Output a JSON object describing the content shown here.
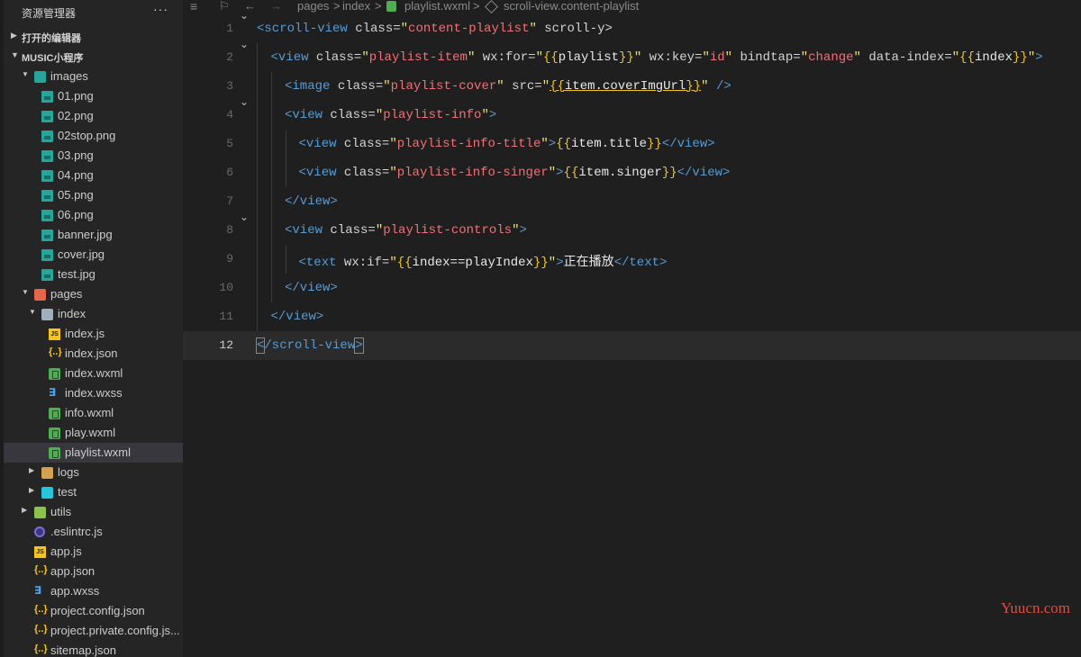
{
  "explorer": {
    "title": "资源管理器",
    "more": "···",
    "open_editors": "打开的编辑器",
    "project": "MUSIC小程序"
  },
  "tree": [
    {
      "name": "images",
      "type": "folder-images",
      "depth": 1,
      "expanded": true
    },
    {
      "name": "01.png",
      "type": "img",
      "depth": 2
    },
    {
      "name": "02.png",
      "type": "img",
      "depth": 2
    },
    {
      "name": "02stop.png",
      "type": "img",
      "depth": 2
    },
    {
      "name": "03.png",
      "type": "img",
      "depth": 2
    },
    {
      "name": "04.png",
      "type": "img",
      "depth": 2
    },
    {
      "name": "05.png",
      "type": "img",
      "depth": 2
    },
    {
      "name": "06.png",
      "type": "img",
      "depth": 2
    },
    {
      "name": "banner.jpg",
      "type": "img",
      "depth": 2
    },
    {
      "name": "cover.jpg",
      "type": "img",
      "depth": 2
    },
    {
      "name": "test.jpg",
      "type": "img",
      "depth": 2
    },
    {
      "name": "pages",
      "type": "folder-pages",
      "depth": 1,
      "expanded": true
    },
    {
      "name": "index",
      "type": "folder-plain",
      "depth": 2,
      "expanded": true
    },
    {
      "name": "index.js",
      "type": "js",
      "depth": 3
    },
    {
      "name": "index.json",
      "type": "json",
      "depth": 3
    },
    {
      "name": "index.wxml",
      "type": "wxml",
      "depth": 3
    },
    {
      "name": "index.wxss",
      "type": "css",
      "depth": 3
    },
    {
      "name": "info.wxml",
      "type": "wxml",
      "depth": 3
    },
    {
      "name": "play.wxml",
      "type": "wxml",
      "depth": 3
    },
    {
      "name": "playlist.wxml",
      "type": "wxml",
      "depth": 3,
      "selected": true
    },
    {
      "name": "logs",
      "type": "folder",
      "depth": 2,
      "expanded": false
    },
    {
      "name": "test",
      "type": "folder-teal",
      "depth": 2,
      "expanded": false
    },
    {
      "name": "utils",
      "type": "folder-green",
      "depth": 1,
      "expanded": false
    },
    {
      "name": ".eslintrc.js",
      "type": "eslint",
      "depth": 1
    },
    {
      "name": "app.js",
      "type": "js",
      "depth": 1
    },
    {
      "name": "app.json",
      "type": "json",
      "depth": 1
    },
    {
      "name": "app.wxss",
      "type": "css",
      "depth": 1
    },
    {
      "name": "project.config.json",
      "type": "json",
      "depth": 1
    },
    {
      "name": "project.private.config.js...",
      "type": "json",
      "depth": 1
    },
    {
      "name": "sitemap.json",
      "type": "json",
      "depth": 1
    }
  ],
  "breadcrumb": {
    "list_icon": "≡",
    "bookmark_icon": "⚐",
    "back": "←",
    "forward": "→",
    "parts": [
      "pages",
      "index",
      "playlist.wxml",
      "scroll-view.content-playlist"
    ],
    "sep": ">"
  },
  "editor": {
    "current_line": 12,
    "lines": [
      {
        "n": "1",
        "indent": 0,
        "fold": true
      },
      {
        "n": "2",
        "indent": 1,
        "fold": true
      },
      {
        "n": "3",
        "indent": 2
      },
      {
        "n": "4",
        "indent": 2,
        "fold": true
      },
      {
        "n": "5",
        "indent": 3
      },
      {
        "n": "6",
        "indent": 3
      },
      {
        "n": "7",
        "indent": 2
      },
      {
        "n": "8",
        "indent": 2,
        "fold": true
      },
      {
        "n": "9",
        "indent": 3
      },
      {
        "n": "10",
        "indent": 2
      },
      {
        "n": "11",
        "indent": 1
      },
      {
        "n": "12",
        "indent": 0
      }
    ],
    "code": {
      "l1": [
        "<scroll-view",
        " class=",
        "\"",
        "content-playlist",
        "\"",
        " scroll-y>"
      ],
      "l2": [
        "<view",
        " class=",
        "\"",
        "playlist-item",
        "\"",
        " wx:for=",
        "\"",
        "{{",
        "playlist",
        "}}",
        "\"",
        " wx:key=",
        "\"",
        "id",
        "\"",
        " bindtap=",
        "\"",
        "change",
        "\"",
        " data-index=",
        "\"",
        "{{",
        "index",
        "}}",
        "\"",
        ">"
      ],
      "l3": [
        "<image",
        " class=",
        "\"",
        "playlist-cover",
        "\"",
        " src=",
        "\"",
        "{{",
        "item.coverImgUrl",
        "}}",
        "\"",
        " />"
      ],
      "l4": [
        "<view",
        " class=",
        "\"",
        "playlist-info",
        "\"",
        ">"
      ],
      "l5": [
        "<view",
        " class=",
        "\"",
        "playlist-info-title",
        "\"",
        ">",
        "{{",
        "item.title",
        "}}",
        "</view>"
      ],
      "l6": [
        "<view",
        " class=",
        "\"",
        "playlist-info-singer",
        "\"",
        ">",
        "{{",
        "item.singer",
        "}}",
        "</view>"
      ],
      "l7": [
        "</view>"
      ],
      "l8": [
        "<view",
        " class=",
        "\"",
        "playlist-controls",
        "\"",
        ">"
      ],
      "l9": [
        "<text",
        " wx:if=",
        "\"",
        "{{",
        "index==playIndex",
        "}}",
        "\"",
        ">",
        "正在播放",
        "</text>"
      ],
      "l10": [
        "</view>"
      ],
      "l11": [
        "</view>"
      ],
      "l12": [
        "<",
        "/scroll-view",
        ">"
      ]
    }
  },
  "watermark": "Yuucn.com",
  "colors": {
    "tag": "#569cd6",
    "string": "#f07178",
    "brace": "#f5c518",
    "bg": "#1f1f1f",
    "sidebar": "#252526"
  }
}
